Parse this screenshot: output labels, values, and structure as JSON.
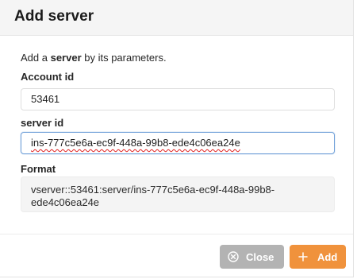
{
  "dialog": {
    "title": "Add server",
    "description_prefix": "Add a ",
    "description_bold": "server",
    "description_suffix": " by its parameters."
  },
  "fields": {
    "account_id": {
      "label": "Account id",
      "value": "53461"
    },
    "server_id": {
      "label": "server id",
      "value": "ins-777c5e6a-ec9f-448a-99b8-ede4c06ea24e"
    },
    "format": {
      "label": "Format",
      "value": "vserver::53461:server/ins-777c5e6a-ec9f-448a-99b8-ede4c06ea24e"
    }
  },
  "buttons": {
    "close_label": "Close",
    "close_icon": "close-circle-icon",
    "add_label": "Add",
    "add_icon": "plus-icon"
  },
  "colors": {
    "header_bg": "#f5f5f5",
    "add_button": "#f0923c",
    "close_button": "#b3b3b3",
    "focus_border": "#6f9fd8"
  }
}
